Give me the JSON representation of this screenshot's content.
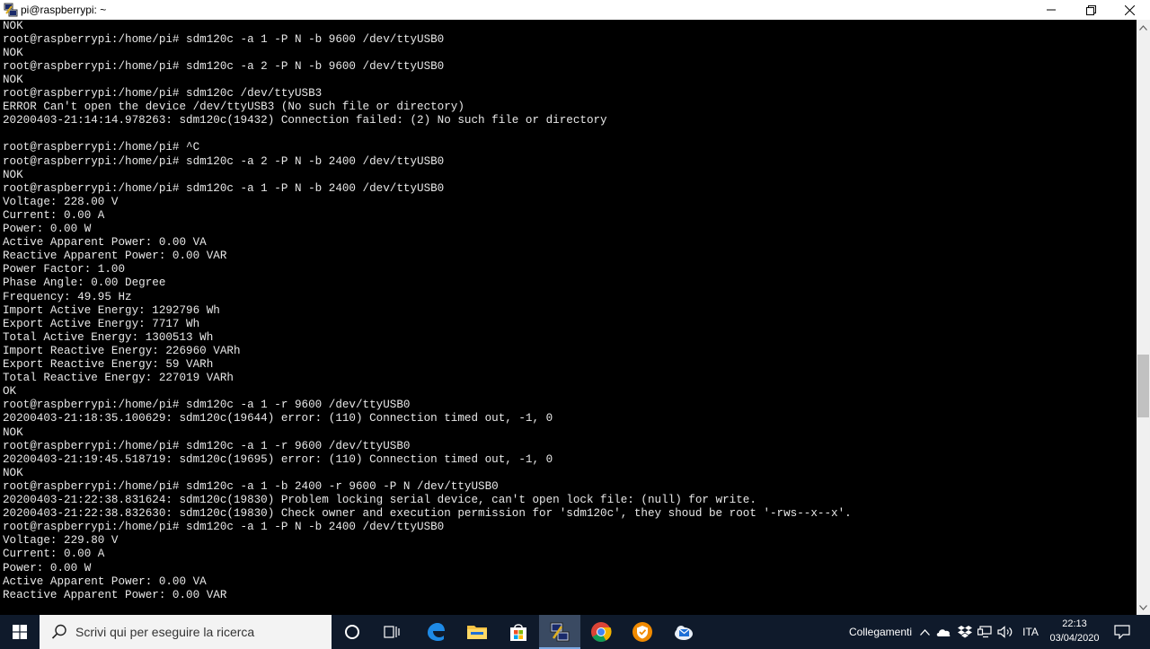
{
  "window": {
    "title": "pi@raspberrypi: ~"
  },
  "terminal": {
    "lines": [
      "NOK",
      "root@raspberrypi:/home/pi# sdm120c -a 1 -P N -b 9600 /dev/ttyUSB0",
      "NOK",
      "root@raspberrypi:/home/pi# sdm120c -a 2 -P N -b 9600 /dev/ttyUSB0",
      "NOK",
      "root@raspberrypi:/home/pi# sdm120c /dev/ttyUSB3",
      "ERROR Can't open the device /dev/ttyUSB3 (No such file or directory)",
      "20200403-21:14:14.978263: sdm120c(19432) Connection failed: (2) No such file or directory",
      "",
      "root@raspberrypi:/home/pi# ^C",
      "root@raspberrypi:/home/pi# sdm120c -a 2 -P N -b 2400 /dev/ttyUSB0",
      "NOK",
      "root@raspberrypi:/home/pi# sdm120c -a 1 -P N -b 2400 /dev/ttyUSB0",
      "Voltage: 228.00 V",
      "Current: 0.00 A",
      "Power: 0.00 W",
      "Active Apparent Power: 0.00 VA",
      "Reactive Apparent Power: 0.00 VAR",
      "Power Factor: 1.00",
      "Phase Angle: 0.00 Degree",
      "Frequency: 49.95 Hz",
      "Import Active Energy: 1292796 Wh",
      "Export Active Energy: 7717 Wh",
      "Total Active Energy: 1300513 Wh",
      "Import Reactive Energy: 226960 VARh",
      "Export Reactive Energy: 59 VARh",
      "Total Reactive Energy: 227019 VARh",
      "OK",
      "root@raspberrypi:/home/pi# sdm120c -a 1 -r 9600 /dev/ttyUSB0",
      "20200403-21:18:35.100629: sdm120c(19644) error: (110) Connection timed out, -1, 0",
      "NOK",
      "root@raspberrypi:/home/pi# sdm120c -a 1 -r 9600 /dev/ttyUSB0",
      "20200403-21:19:45.518719: sdm120c(19695) error: (110) Connection timed out, -1, 0",
      "NOK",
      "root@raspberrypi:/home/pi# sdm120c -a 1 -b 2400 -r 9600 -P N /dev/ttyUSB0",
      "20200403-21:22:38.831624: sdm120c(19830) Problem locking serial device, can't open lock file: (null) for write.",
      "20200403-21:22:38.832630: sdm120c(19830) Check owner and execution permission for 'sdm120c', they shoud be root '-rws--x--x'.",
      "root@raspberrypi:/home/pi# sdm120c -a 1 -P N -b 2400 /dev/ttyUSB0",
      "Voltage: 229.80 V",
      "Current: 0.00 A",
      "Power: 0.00 W",
      "Active Apparent Power: 0.00 VA",
      "Reactive Apparent Power: 0.00 VAR"
    ]
  },
  "taskbar": {
    "search_placeholder": "Scrivi qui per eseguire la ricerca",
    "tray_label": "Collegamenti",
    "language": "ITA",
    "time": "22:13",
    "date": "03/04/2020"
  },
  "colors": {
    "terminal_bg": "#000000",
    "terminal_fg": "#e8e8e8",
    "taskbar_bg": "#0f1a2b"
  }
}
